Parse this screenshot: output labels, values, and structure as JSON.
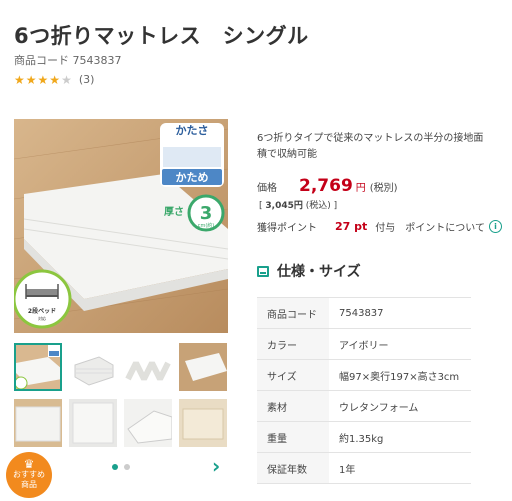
{
  "product": {
    "title": "6つ折りマットレス　シングル",
    "code_line": "商品コード 7543837",
    "rating": {
      "stars": 4,
      "max": 5,
      "count_text": "(3)"
    }
  },
  "image": {
    "firmness_top": "かたさ",
    "firmness_bottom": "かため",
    "thickness_label": "厚さ",
    "thickness_value": "3",
    "thickness_unit": "cm(約)",
    "bunk_label": "2段ベッド",
    "bunk_sub": "対応"
  },
  "gallery": {
    "dots": 2,
    "active_dot": 0
  },
  "badge": {
    "line1": "おすすめ",
    "line2": "商品"
  },
  "description": "6つ折りタイプで従来のマットレスの半分の接地面積で収納可能",
  "price": {
    "label": "価格",
    "value": "2,769",
    "unit": "円",
    "tax_note": "(税別)",
    "taxin_open": "[",
    "taxin_value": "3,045",
    "taxin_unit": "円",
    "taxin_note": "(税込)",
    "taxin_close": "]"
  },
  "points": {
    "label": "獲得ポイント",
    "value": "27 pt",
    "suffix": "付与",
    "link": "ポイントについて"
  },
  "spec": {
    "title": "仕様・サイズ",
    "rows": [
      {
        "key": "商品コード",
        "value": "7543837"
      },
      {
        "key": "カラー",
        "value": "アイボリー"
      },
      {
        "key": "サイズ",
        "value": "幅97×奥行197×高さ3cm"
      },
      {
        "key": "素材",
        "value": "ウレタンフォーム"
      },
      {
        "key": "重量",
        "value": "約1.35kg"
      },
      {
        "key": "保証年数",
        "value": "1年"
      }
    ]
  },
  "colors": {
    "accent": "#19a08c",
    "price": "#c40018",
    "star": "#f0a81c",
    "badge": "#f28a1e"
  }
}
